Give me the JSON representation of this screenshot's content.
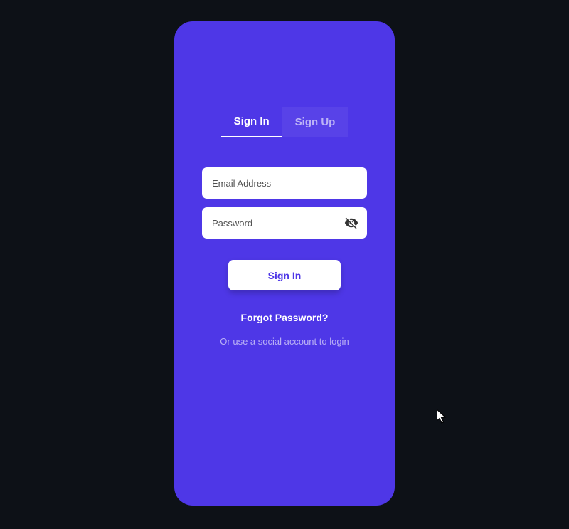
{
  "tabs": {
    "signin": "Sign In",
    "signup": "Sign Up"
  },
  "inputs": {
    "email_placeholder": "Email Address",
    "password_placeholder": "Password"
  },
  "buttons": {
    "signin": "Sign In"
  },
  "links": {
    "forgot_password": "Forgot Password?",
    "social_login": "Or use a social account to login"
  }
}
